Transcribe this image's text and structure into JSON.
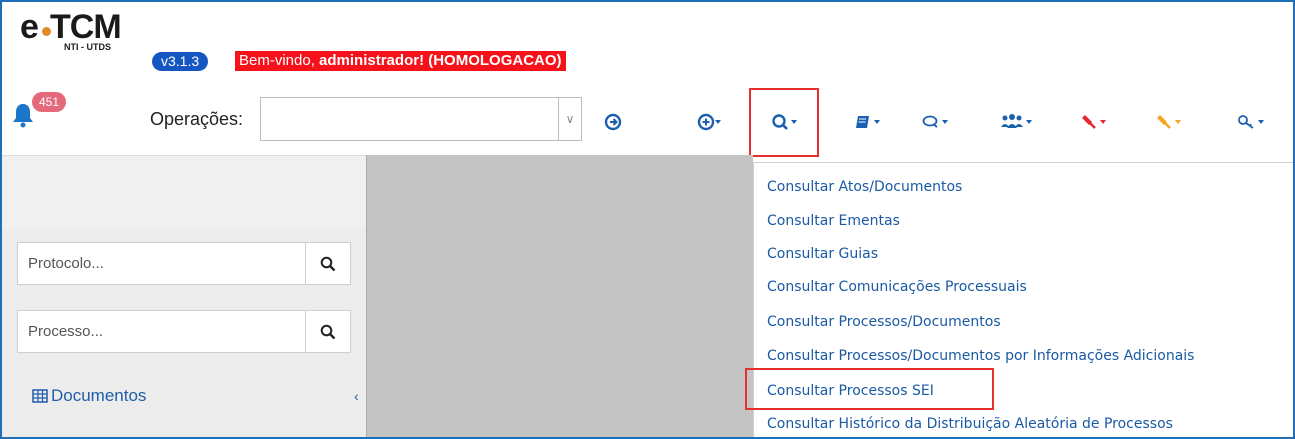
{
  "header": {
    "logo_text": "e-TCM",
    "logo_sub": "NTI - UTDS",
    "version": "v3.1.3",
    "welcome_prefix": "Bem-vindo, ",
    "welcome_bold": "administrador! (HOMOLOGACAO)",
    "notification_count": "451",
    "operations_label": "Operações:",
    "operations_value": ""
  },
  "toolbar": {
    "icons": [
      "go-arrow-icon",
      "add-icon",
      "search-icon",
      "book-icon",
      "chat-icon",
      "users-icon",
      "gavel-red-icon",
      "gavel-orange-icon",
      "key-search-icon"
    ],
    "active": "search-icon"
  },
  "sidebar": {
    "protocol_placeholder": "Protocolo...",
    "process_placeholder": "Processo...",
    "documents_label": "Documentos"
  },
  "menu": {
    "items": [
      "Consultar Atos/Documentos",
      "Consultar Ementas",
      "Consultar Guias",
      "Consultar Comunicações Processuais",
      "Consultar Processos/Documentos",
      "Consultar Processos/Documentos por Informações Adicionais",
      "Consultar Processos SEI",
      "Consultar Histórico da Distribuição Aleatória de Processos"
    ],
    "highlighted": "Consultar Processos SEI"
  },
  "colors": {
    "accent": "#1557c2",
    "welcome_bg": "#f5121b",
    "link": "#1a5aa3",
    "highlight_border": "#e53030"
  }
}
